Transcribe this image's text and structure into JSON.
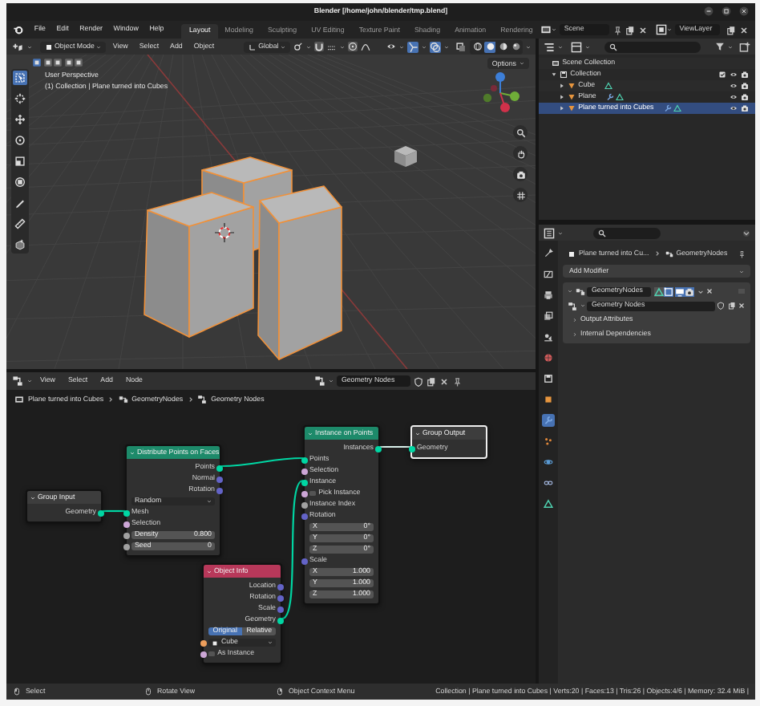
{
  "window": {
    "title": "Blender [/home/john/blender/tmp.blend]"
  },
  "menu": [
    "File",
    "Edit",
    "Render",
    "Window",
    "Help"
  ],
  "workspaces": [
    {
      "label": "Layout",
      "selected": true
    },
    {
      "label": "Modeling",
      "selected": false
    },
    {
      "label": "Sculpting",
      "selected": false
    },
    {
      "label": "UV Editing",
      "selected": false
    },
    {
      "label": "Texture Paint",
      "selected": false
    },
    {
      "label": "Shading",
      "selected": false
    },
    {
      "label": "Animation",
      "selected": false
    },
    {
      "label": "Rendering",
      "selected": false
    }
  ],
  "scene": "Scene",
  "view_layer": "ViewLayer",
  "viewport": {
    "mode": "Object Mode",
    "menu": [
      "View",
      "Select",
      "Add",
      "Object"
    ],
    "orientation": "Global",
    "options": "Options",
    "select_modes": [
      {
        "selected": true
      },
      {
        "selected": false
      },
      {
        "selected": false
      },
      {
        "selected": false
      },
      {
        "selected": false
      }
    ],
    "shading": [
      {
        "kind": "wireframe",
        "selected": false
      },
      {
        "kind": "solid",
        "selected": true
      },
      {
        "kind": "material",
        "selected": false
      },
      {
        "kind": "rendered",
        "selected": false
      }
    ],
    "tools": [
      {
        "kind": "select",
        "selected": true
      },
      {
        "kind": "cursor",
        "selected": false
      },
      {
        "kind": "move",
        "selected": false
      },
      {
        "kind": "rotate",
        "selected": false
      },
      {
        "kind": "scale",
        "selected": false
      },
      {
        "kind": "transform",
        "selected": false
      },
      {
        "kind": "annotate",
        "selected": false
      },
      {
        "kind": "measure",
        "selected": false
      },
      {
        "kind": "add_cube",
        "selected": false
      }
    ],
    "info": [
      "User Perspective",
      "(1) Collection | Plane turned into Cubes"
    ]
  },
  "outliner": {
    "items": [
      {
        "label": "Scene Collection",
        "kind": "scene",
        "selected": false,
        "children": [
          {
            "label": "Collection",
            "kind": "collection",
            "selected": false,
            "expanded": true,
            "children": [
              {
                "label": "Cube",
                "kind": "object",
                "selected": false,
                "expanded": false,
                "modifier": false
              },
              {
                "label": "Plane",
                "kind": "object",
                "selected": false,
                "expanded": false,
                "modifier": true
              },
              {
                "label": "Plane turned into Cubes",
                "kind": "object",
                "selected": true,
                "expanded": false,
                "modifier": true
              }
            ]
          }
        ]
      }
    ]
  },
  "properties": {
    "tabs": [
      {
        "kind": "tool",
        "selected": false
      },
      {
        "kind": "render",
        "selected": false
      },
      {
        "kind": "output",
        "selected": false
      },
      {
        "kind": "view_layer",
        "selected": false
      },
      {
        "kind": "scene",
        "selected": false
      },
      {
        "kind": "world",
        "selected": false
      },
      {
        "kind": "collection",
        "selected": false
      },
      {
        "kind": "object",
        "selected": false
      },
      {
        "kind": "modifier",
        "selected": true
      },
      {
        "kind": "particles",
        "selected": false
      },
      {
        "kind": "physics",
        "selected": false
      },
      {
        "kind": "constraints",
        "selected": false
      },
      {
        "kind": "data",
        "selected": false
      }
    ],
    "breadcrumb": [
      "Plane turned into Cu...",
      "GeometryNodes"
    ],
    "add_modifier": "Add Modifier",
    "modifier": {
      "name": "GeometryNodes",
      "expanded": true,
      "node_group": "Geometry Nodes",
      "panels": [
        "Output Attributes",
        "Internal Dependencies"
      ]
    }
  },
  "node_editor": {
    "menu": [
      "View",
      "Select",
      "Add",
      "Node"
    ],
    "node_group": "Geometry Nodes",
    "breadcrumb": [
      "Plane turned into Cubes",
      "GeometryNodes",
      "Geometry Nodes"
    ],
    "nodes": [
      {
        "title": "Group Input",
        "color": "#3d3d3d",
        "selected": false,
        "rows": [
          {
            "kind": "output",
            "label": "Geometry",
            "color": "#00d6a3"
          }
        ]
      },
      {
        "title": "Distribute Points on Faces",
        "color": "#1d8a6a",
        "selected": false,
        "rows": [
          {
            "kind": "output",
            "label": "Points",
            "color": "#00d6a3"
          },
          {
            "kind": "output",
            "label": "Normal",
            "color": "#6363c7"
          },
          {
            "kind": "output",
            "label": "Rotation",
            "color": "#6363c7"
          },
          {
            "kind": "dropdown",
            "label": "Random"
          },
          {
            "kind": "input",
            "label": "Mesh",
            "color": "#00d6a3"
          },
          {
            "kind": "input",
            "label": "Selection",
            "color": "#cca6d6"
          },
          {
            "kind": "field",
            "label": "Density",
            "value": "0.800",
            "color": "#a1a1a1"
          },
          {
            "kind": "field",
            "label": "Seed",
            "value": "0",
            "color": "#a1a1a1"
          }
        ]
      },
      {
        "title": "Instance on Points",
        "color": "#1d8a6a",
        "selected": false,
        "rows": [
          {
            "kind": "output",
            "label": "Instances",
            "color": "#00d6a3"
          },
          {
            "kind": "input",
            "label": "Points",
            "color": "#00d6a3"
          },
          {
            "kind": "input",
            "label": "Selection",
            "color": "#cca6d6"
          },
          {
            "kind": "input",
            "label": "Instance",
            "color": "#00d6a3"
          },
          {
            "kind": "checkbox",
            "label": "Pick Instance",
            "checked": false,
            "color": "#cca6d6"
          },
          {
            "kind": "input",
            "label": "Instance Index",
            "color": "#a1a1a1"
          },
          {
            "kind": "vector",
            "label": "Rotation",
            "color": "#6363c7",
            "components": [
              {
                "axis": "X",
                "value": "0°"
              },
              {
                "axis": "Y",
                "value": "0°"
              },
              {
                "axis": "Z",
                "value": "0°"
              }
            ]
          },
          {
            "kind": "vector",
            "label": "Scale",
            "color": "#6363c7",
            "components": [
              {
                "axis": "X",
                "value": "1.000"
              },
              {
                "axis": "Y",
                "value": "1.000"
              },
              {
                "axis": "Z",
                "value": "1.000"
              }
            ]
          }
        ]
      },
      {
        "title": "Group Output",
        "color": "#3d3d3d",
        "selected": true,
        "rows": [
          {
            "kind": "input",
            "label": "Geometry",
            "color": "#00d6a3"
          }
        ]
      },
      {
        "title": "Object Info",
        "color": "#b8385a",
        "selected": false,
        "rows": [
          {
            "kind": "output",
            "label": "Location",
            "color": "#6363c7"
          },
          {
            "kind": "output",
            "label": "Rotation",
            "color": "#6363c7"
          },
          {
            "kind": "output",
            "label": "Scale",
            "color": "#6363c7"
          },
          {
            "kind": "output",
            "label": "Geometry",
            "color": "#00d6a3"
          },
          {
            "kind": "toggle",
            "options": [
              {
                "label": "Original",
                "selected": true
              },
              {
                "label": "Relative",
                "selected": false
              }
            ]
          },
          {
            "kind": "object",
            "label": "Cube",
            "color": "#ed9e5c"
          },
          {
            "kind": "checkbox",
            "label": "As Instance",
            "checked": false,
            "color": "#cca6d6"
          }
        ]
      }
    ]
  },
  "status_bar": {
    "hints": [
      "Select",
      "Rotate View",
      "Object Context Menu"
    ],
    "stats": "Collection | Plane turned into Cubes | Verts:20 | Faces:13 | Tris:26 | Objects:4/6 | Memory: 32.4 MiB |"
  }
}
